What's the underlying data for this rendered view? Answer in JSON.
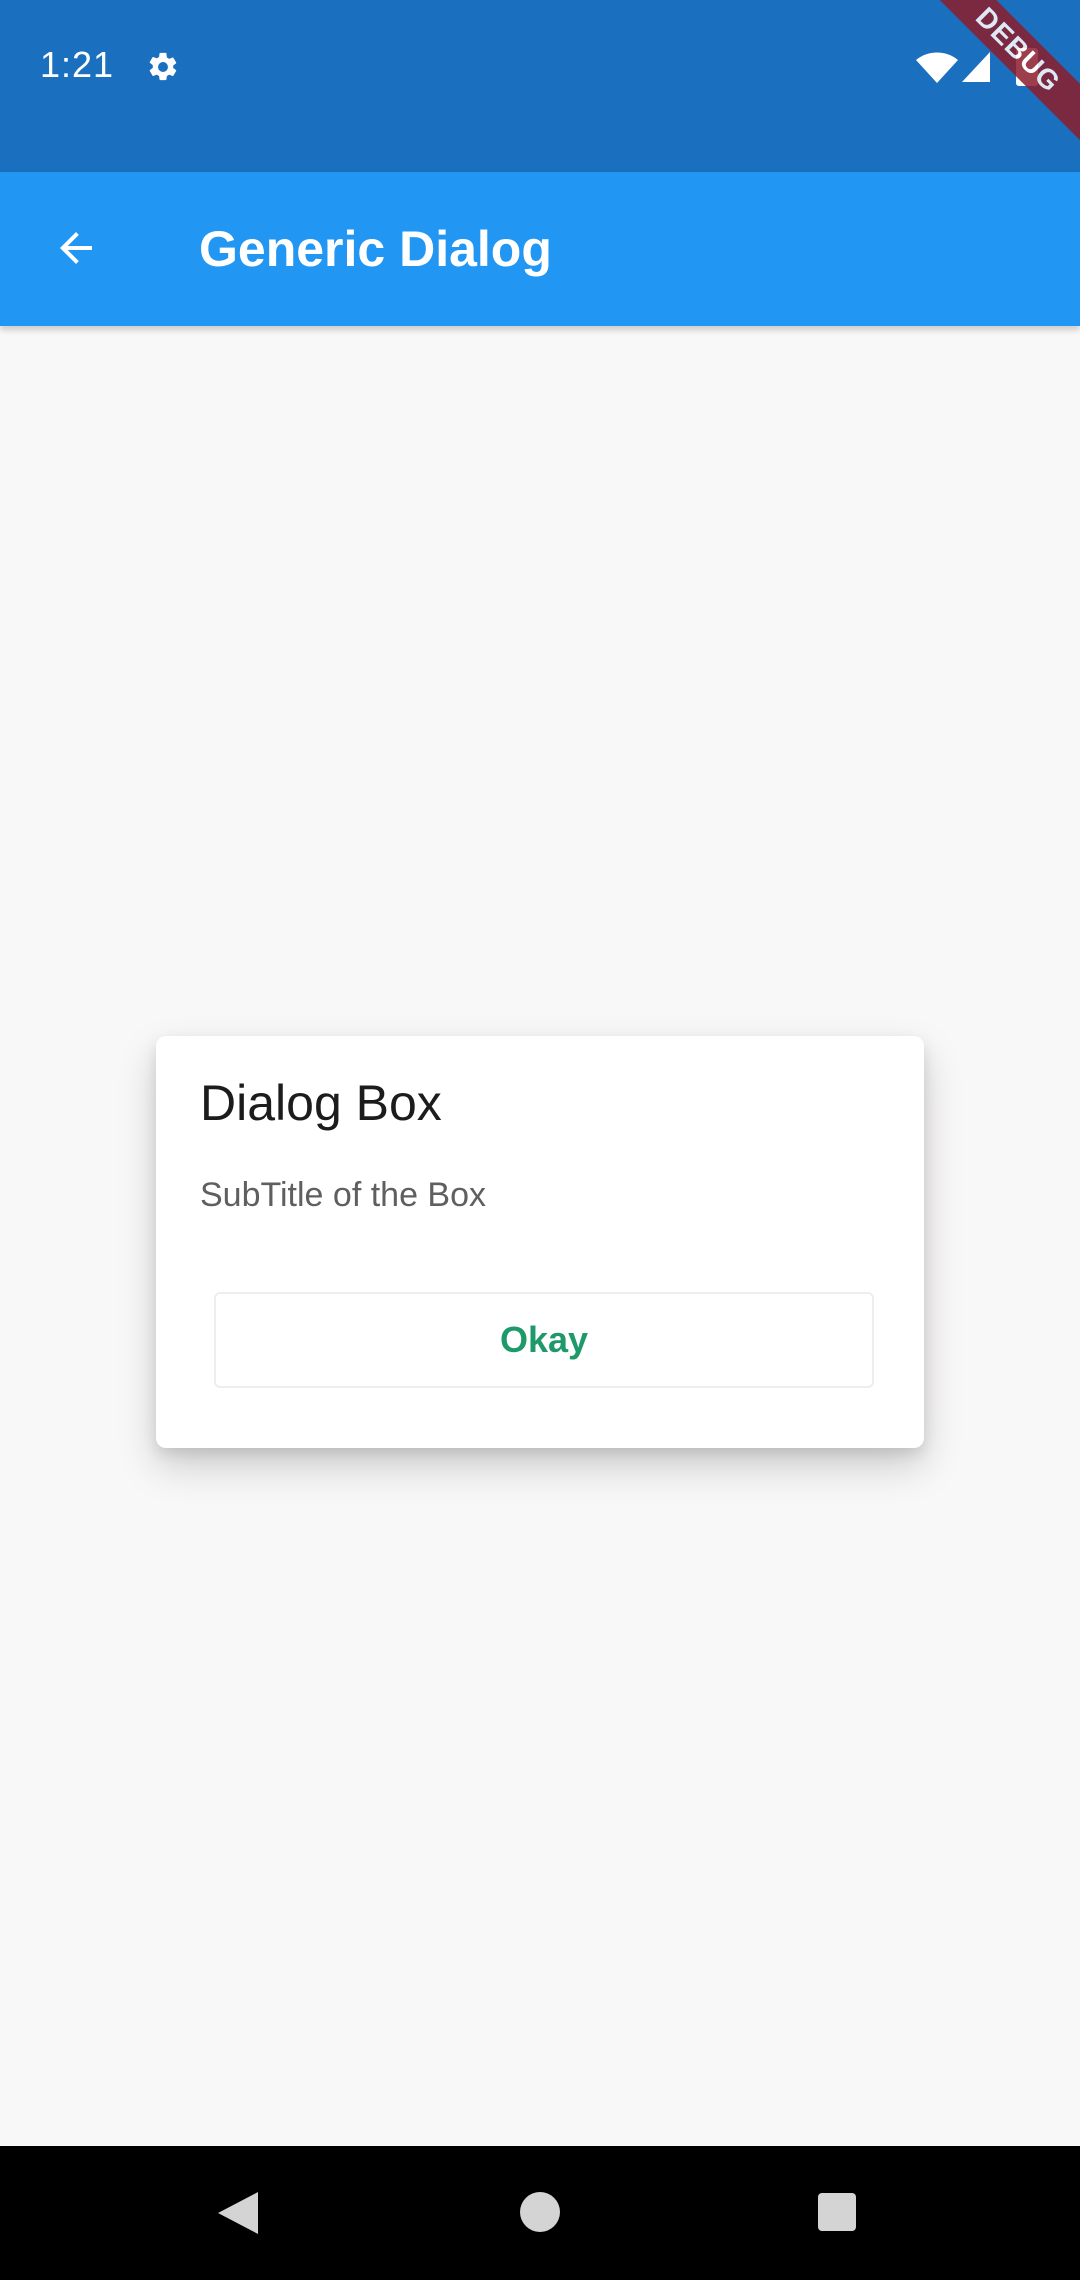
{
  "status_bar": {
    "time": "1:21",
    "icons": [
      "gear-icon",
      "wifi-icon",
      "signal-icon",
      "battery-icon"
    ],
    "debug_banner": "DEBUG",
    "background": "#1a70bf"
  },
  "app_bar": {
    "title": "Generic Dialog",
    "back_icon": "arrow-back-icon",
    "background": "#2196f3"
  },
  "dialog": {
    "title": "Dialog Box",
    "subtitle": "SubTitle of the Box",
    "button_label": "Okay",
    "button_color": "#1e9a6a"
  },
  "nav_bar": {
    "icons": [
      "nav-back-icon",
      "nav-home-icon",
      "nav-recents-icon"
    ]
  }
}
